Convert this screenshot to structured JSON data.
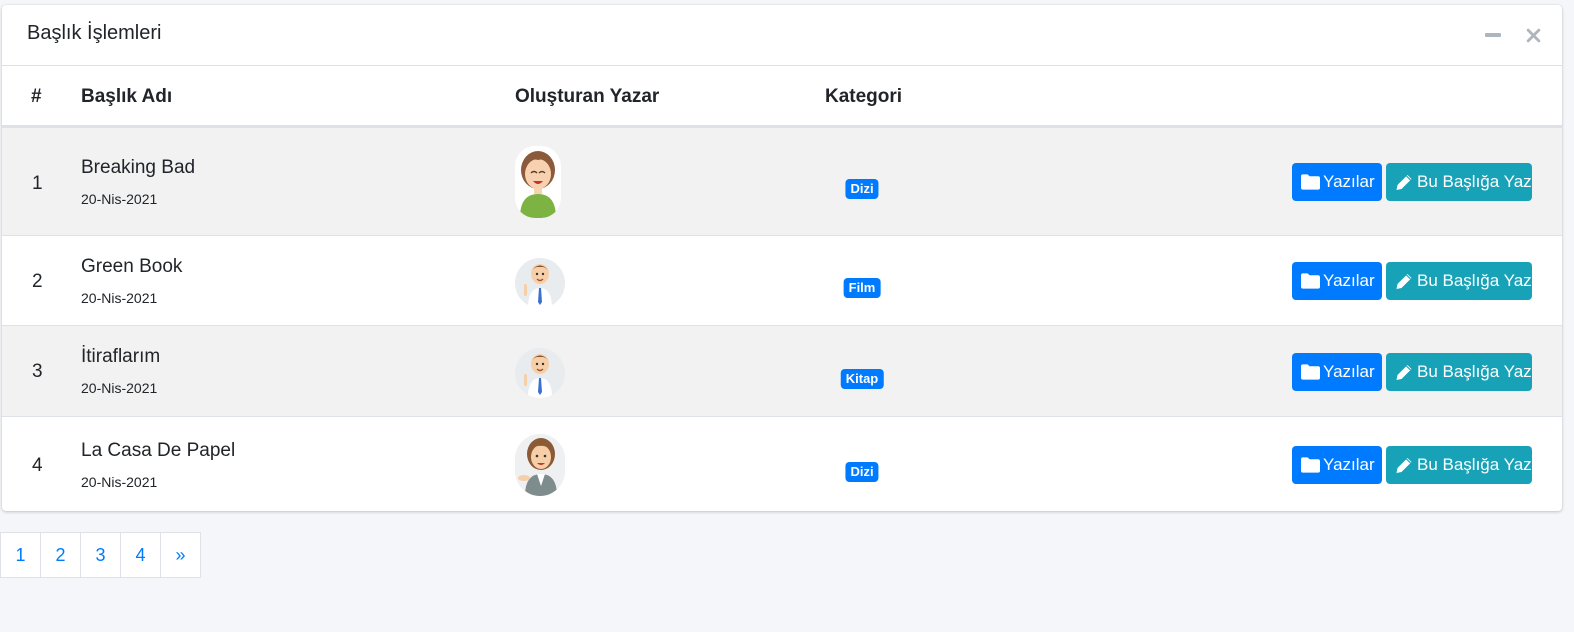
{
  "card": {
    "title": "Başlık İşlemleri",
    "tools": {
      "minimize_icon": "minus-icon",
      "close_icon": "times-icon",
      "icon_color": "#adb5bd"
    }
  },
  "table": {
    "headers": {
      "num": "#",
      "title": "Başlık Adı",
      "author": "Oluşturan Yazar",
      "category": "Kategori"
    },
    "rows": [
      {
        "num": "1",
        "title": "Breaking Bad",
        "date": "20-Nis-2021",
        "category": "Dizi",
        "avatar": "woman-green-shirt-avatar"
      },
      {
        "num": "2",
        "title": "Green Book",
        "date": "20-Nis-2021",
        "category": "Film",
        "avatar": "man-tie-pointing-avatar"
      },
      {
        "num": "3",
        "title": "İtiraflarım",
        "date": "20-Nis-2021",
        "category": "Kitap",
        "avatar": "man-tie-pointing-avatar"
      },
      {
        "num": "4",
        "title": "La Casa De Papel",
        "date": "20-Nis-2021",
        "category": "Dizi",
        "avatar": "woman-suit-avatar"
      }
    ],
    "actions": {
      "posts_label": "Yazılar",
      "write_label": "Bu Başlığa Yaz",
      "posts_icon": "folder-icon",
      "write_icon": "pencil-icon"
    }
  },
  "pagination": {
    "pages": [
      "1",
      "2",
      "3",
      "4"
    ],
    "next": "»"
  },
  "colors": {
    "primary": "#007bff",
    "info": "#17a2b8",
    "striped_row": "#f2f2f2",
    "background": "#f4f6f9"
  }
}
